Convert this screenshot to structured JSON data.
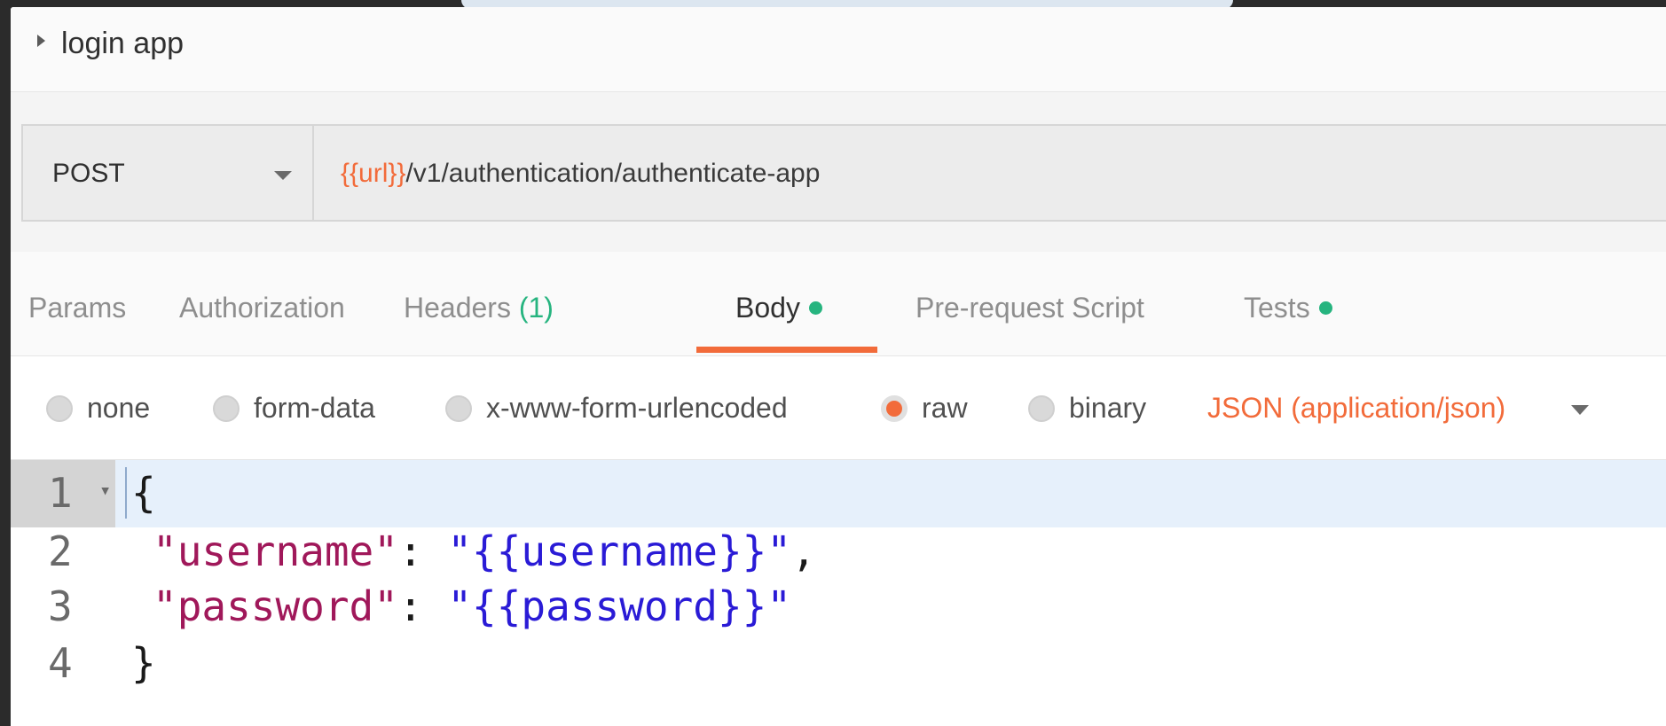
{
  "request": {
    "name": "login app",
    "method": "POST",
    "url_variable": "{{url}}",
    "url_path": "/v1/authentication/authenticate-app"
  },
  "tabs": [
    {
      "label": "Params"
    },
    {
      "label": "Authorization"
    },
    {
      "label": "Headers",
      "count": "(1)"
    },
    {
      "label": "Body",
      "active": true,
      "has_dot": true
    },
    {
      "label": "Pre-request Script"
    },
    {
      "label": "Tests",
      "has_dot": true
    }
  ],
  "body_types": [
    {
      "label": "none",
      "checked": false
    },
    {
      "label": "form-data",
      "checked": false
    },
    {
      "label": "x-www-form-urlencoded",
      "checked": false
    },
    {
      "label": "raw",
      "checked": true
    },
    {
      "label": "binary",
      "checked": false
    }
  ],
  "content_type": "JSON (application/json)",
  "editor": {
    "line_numbers": [
      "1",
      "2",
      "3",
      "4"
    ],
    "fold_marker": "▾",
    "line1": "{",
    "line2_key": "\"username\"",
    "line2_sep": ": ",
    "line2_value": "\"{{username}}\"",
    "line2_end": ",",
    "line3_key": "\"password\"",
    "line3_sep": ": ",
    "line3_value": "\"{{password}}\"",
    "line4": "}"
  },
  "colors": {
    "accent": "#f26b3a",
    "status_green": "#26b47f",
    "json_key": "#a0185a",
    "json_value": "#2a1bd6"
  },
  "icons": {
    "collapse": "caret-right-icon",
    "method_dropdown": "chevron-down-icon",
    "content_type_dropdown": "chevron-down-icon"
  }
}
